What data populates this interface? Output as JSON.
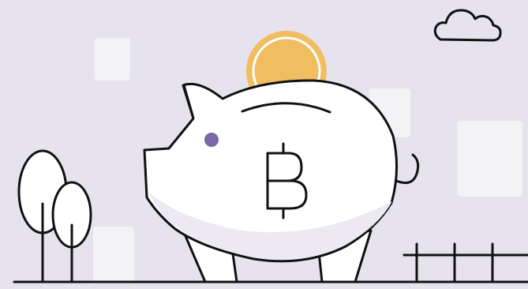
{
  "illustration": {
    "subject": "piggy-bank-bitcoin",
    "icons": [
      "cloud-icon",
      "bitcoin-icon",
      "coin-icon",
      "tree-icon",
      "fence-icon"
    ],
    "colors": {
      "background": "#e6e3ee",
      "tile": "#f3f2f5",
      "outline": "#111111",
      "pig_body": "#ffffff",
      "pig_shadow": "#ece9f2",
      "coin": "#f0bd61",
      "coin_ring": "#ffffff",
      "eye": "#7a67a6"
    }
  }
}
